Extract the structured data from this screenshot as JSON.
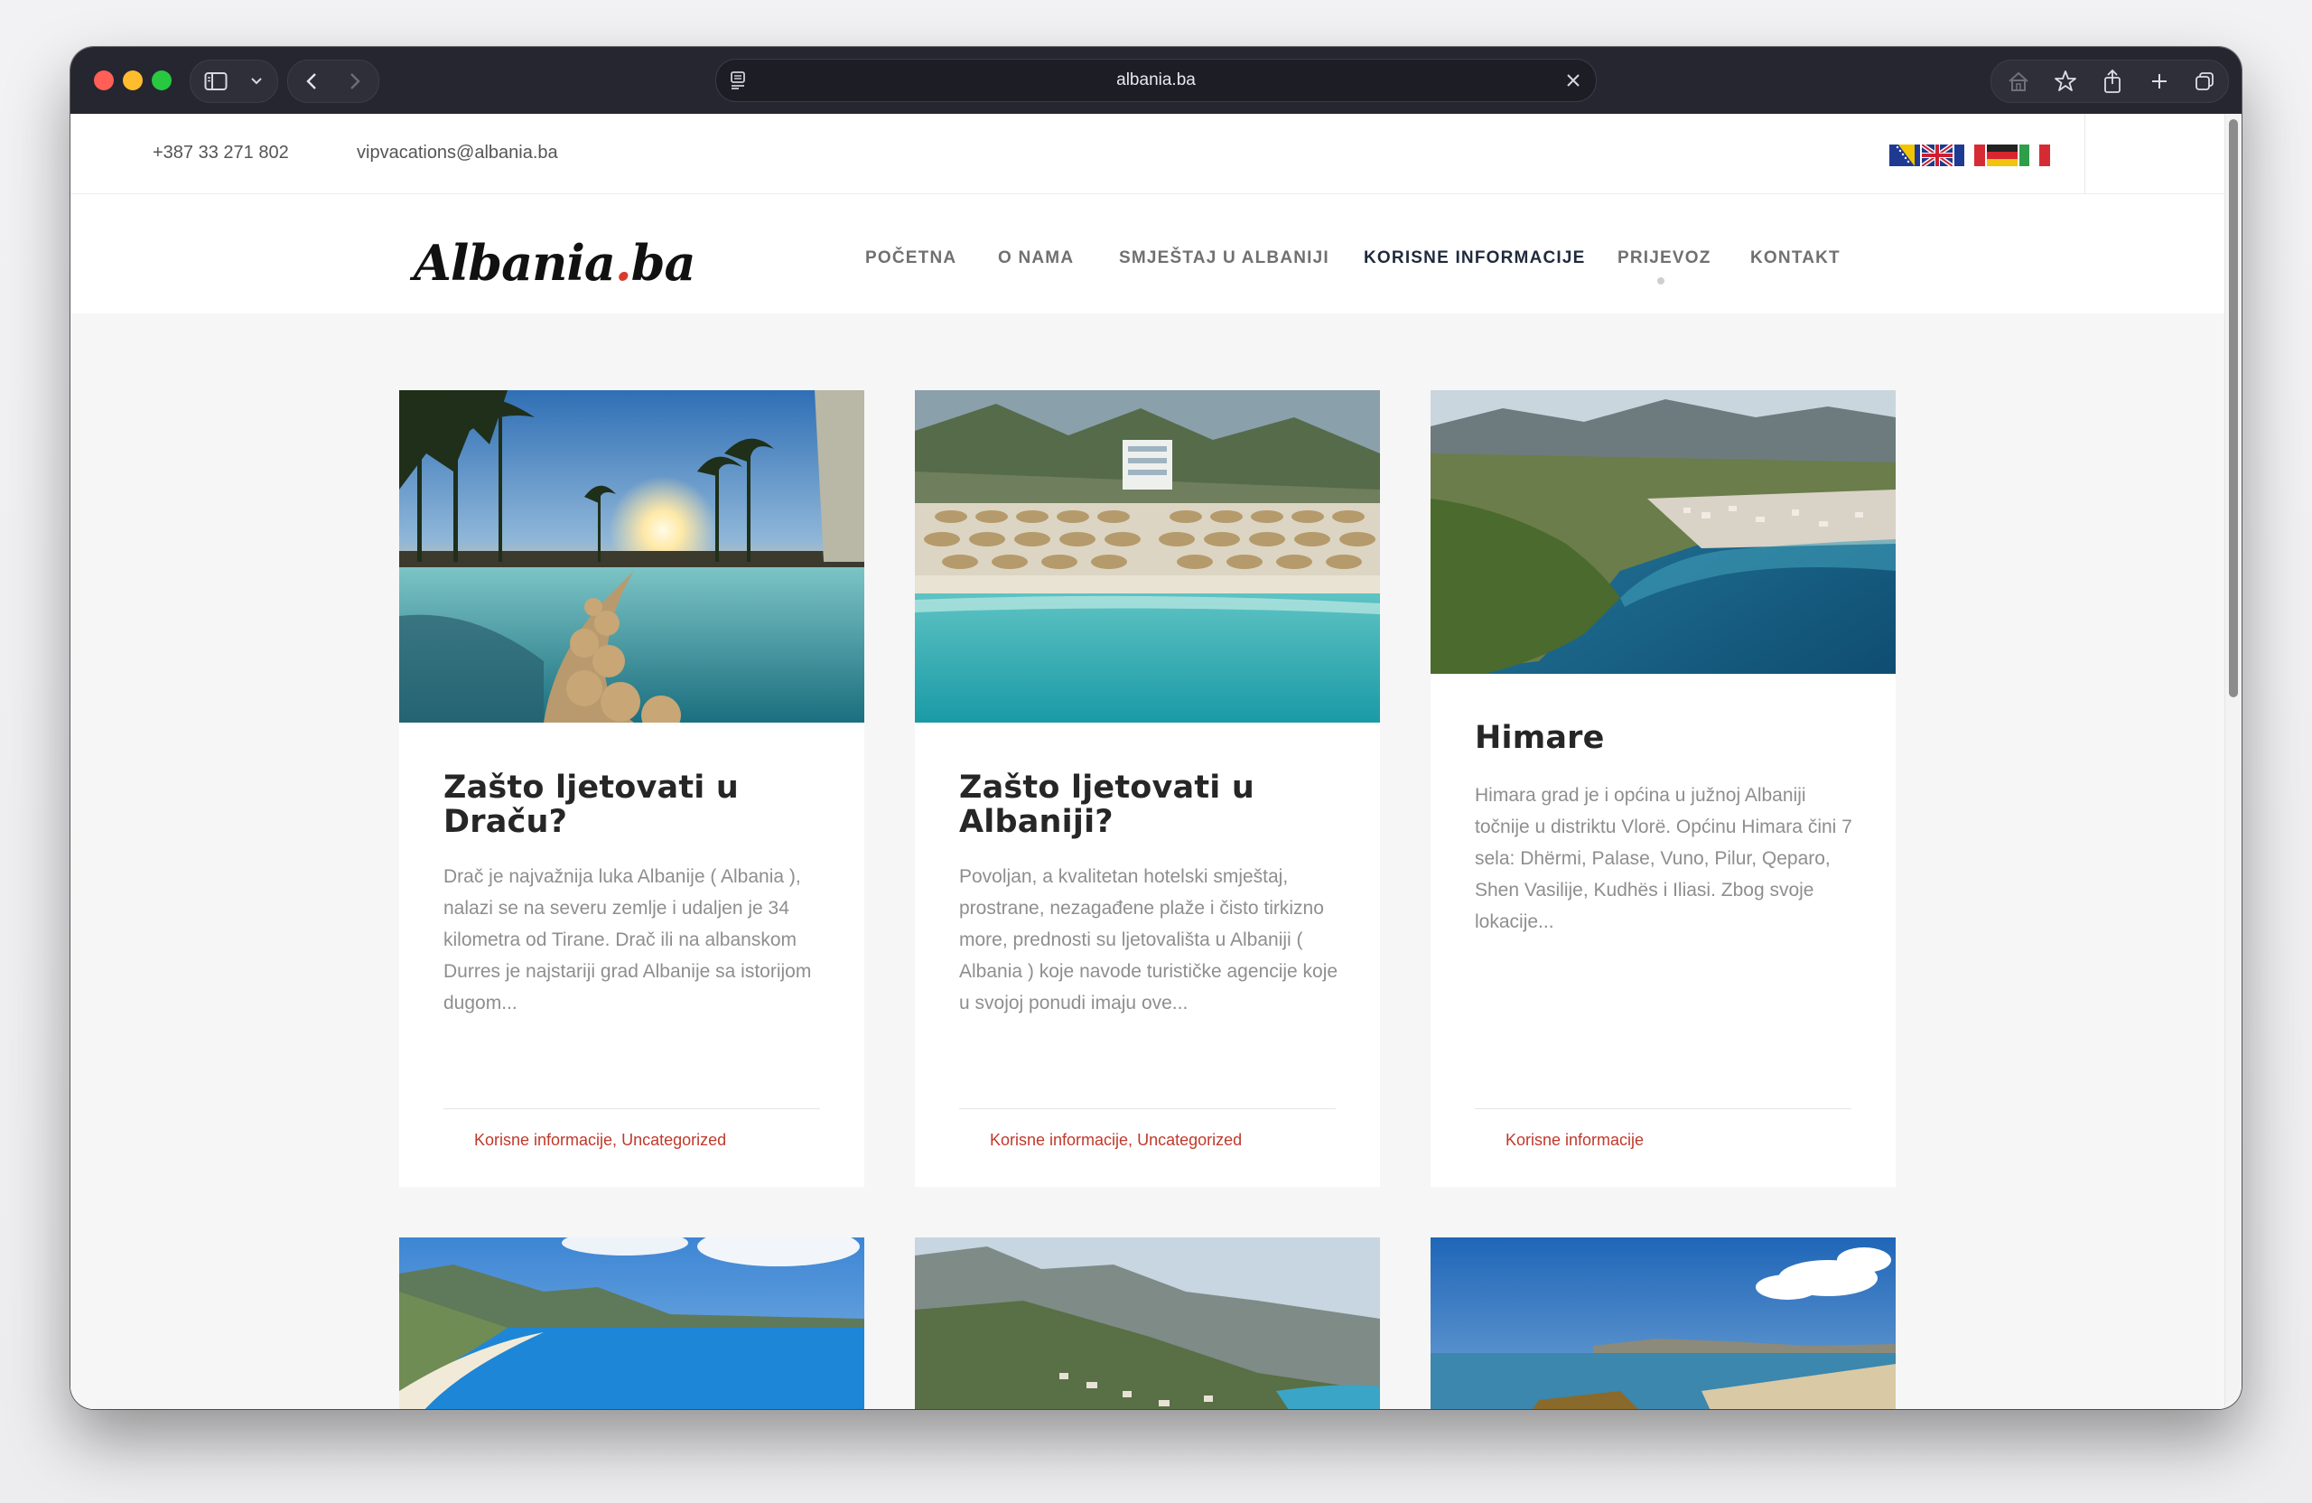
{
  "browser": {
    "url": "albania.ba"
  },
  "topbar": {
    "phone": "+387 33 271 802",
    "email": "vipvacations@albania.ba",
    "languages": [
      "bs",
      "en",
      "fr",
      "de",
      "it"
    ]
  },
  "header": {
    "logo_main": "Albania",
    "logo_dot": ".",
    "logo_tld": "ba",
    "nav": [
      {
        "label": "POČETNA",
        "active": false
      },
      {
        "label": "O NAMA",
        "active": false
      },
      {
        "label": "SMJEŠTAJ U ALBANIJI",
        "active": false
      },
      {
        "label": "KORISNE INFORMACIJE",
        "active": true
      },
      {
        "label": "PRIJEVOZ",
        "active": false
      },
      {
        "label": "KONTAKT",
        "active": false
      }
    ]
  },
  "posts": [
    {
      "title": "Zašto ljetovati u Draču?",
      "excerpt": "Drač je najvažnija luka Albanije ( Albania ), nalazi se na severu zemlje i udaljen je 34 kilometra od Tirane. Drač ili na albanskom Durres je najstariji grad Albanije sa istorijom dugom...",
      "categories": "Korisne informacije, Uncategorized",
      "image": "resort-pool-sunset"
    },
    {
      "title": "Zašto ljetovati u Albaniji?",
      "excerpt": "Povoljan, a kvalitetan hotelski smještaj, prostrane, nezagađene plaže i čisto tirkizno more, prednosti su ljetovališta u Albaniji ( Albania ) koje navode turističke agencije koje u svojoj ponudi imaju ove...",
      "categories": "Korisne informacije, Uncategorized",
      "image": "beach-hotel-umbrellas"
    },
    {
      "title": "Himare",
      "excerpt": "Himara grad je i općina u južnoj Albaniji točnije u distriktu Vlorë. Općinu Himara čini 7 sela: Dhërmi, Palase, Vuno, Pilur, Qeparo, Shen Vasilije, Kudhës i Iliasi. Zbog svoje lokacije...",
      "categories": "Korisne informacije",
      "image": "himare-bay-aerial"
    },
    {
      "image": "coast-bay-blue"
    },
    {
      "image": "mountain-village-coast"
    },
    {
      "image": "durres-beach-sky"
    }
  ],
  "colors": {
    "accent": "#c0392b",
    "nav_active": "#1f2a3c"
  }
}
